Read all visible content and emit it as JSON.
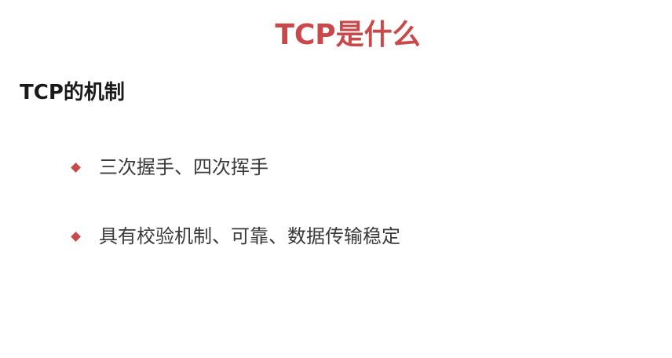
{
  "slide": {
    "title": "TCP是什么",
    "subtitle": "TCP的机制",
    "bullets": [
      {
        "text": "三次握手、四次挥手",
        "icon": "diamond-bullet-icon"
      },
      {
        "text": "具有校验机制、可靠、数据传输稳定",
        "icon": "diamond-bullet-icon"
      }
    ]
  },
  "colors": {
    "title": "#c9484a",
    "bullet": "#c9484a",
    "subtitle": "#1a1a1a",
    "body": "#3a3a3a"
  }
}
